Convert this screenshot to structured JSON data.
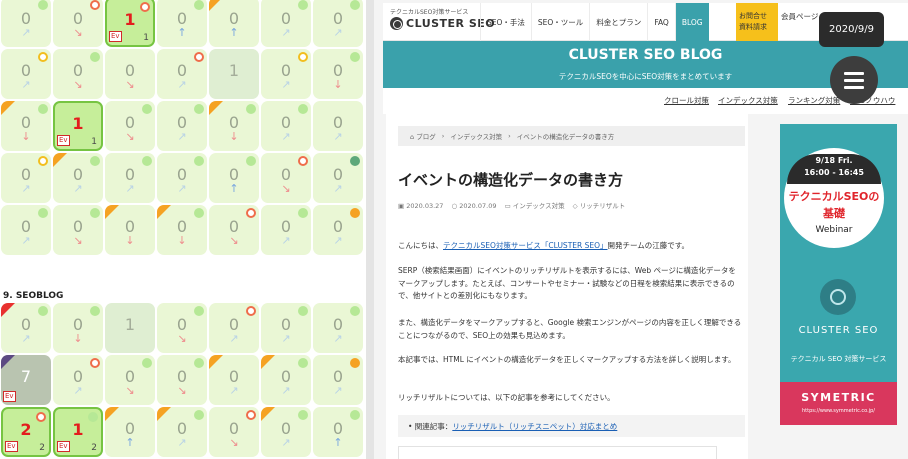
{
  "heatmap": {
    "section_label": "9. SEOBLOG",
    "ev_label": "Ev",
    "colors": {
      "cell": "#eaf7d5",
      "selected": "#c6ee9a",
      "selected_border": "#76c442",
      "hot_number": "#e31d1d"
    },
    "block1": [
      [
        {
          "v": "0",
          "a": "↗",
          "ac": "#b9d3e6",
          "dot": "green"
        },
        {
          "v": "0",
          "a": "↘",
          "ac": "#ee8d8d",
          "dot": "ring"
        },
        {
          "v": "1",
          "sel": true,
          "ev": true,
          "cnt": "1",
          "dot": "ring"
        },
        {
          "v": "0",
          "a": "↑",
          "ac": "#7aa7df",
          "dot": "green"
        },
        {
          "v": "0",
          "a": "↑",
          "ac": "#7aa7df",
          "tri": "or"
        },
        {
          "v": "0",
          "a": "↗",
          "ac": "#b9d3e6",
          "dot": "green"
        },
        {
          "v": "0",
          "a": "↗",
          "ac": "#b9d3e6",
          "dot": "green"
        }
      ],
      [
        {
          "v": "0",
          "a": "↗",
          "ac": "#b9d3e6",
          "dot": "yel"
        },
        {
          "v": "0",
          "a": "↘",
          "ac": "#ee8d8d",
          "dot": "green"
        },
        {
          "v": "0",
          "a": "↘",
          "ac": "#ee8d8d"
        },
        {
          "v": "0",
          "a": "↗",
          "ac": "#b9d3e6",
          "dot": "ring"
        },
        {
          "v": "1",
          "muted": true
        },
        {
          "v": "0",
          "a": "↗",
          "ac": "#b9d3e6",
          "dot": "yel"
        },
        {
          "v": "0",
          "a": "↓",
          "ac": "#ee8d8d",
          "dot": "green"
        }
      ],
      [
        {
          "v": "0",
          "a": "↓",
          "ac": "#ee8d8d",
          "tri": "or",
          "dot": "green"
        },
        {
          "v": "1",
          "sel": true,
          "ev": true,
          "cnt": "1"
        },
        {
          "v": "0",
          "a": "↘",
          "ac": "#ee8d8d",
          "dot": "green"
        },
        {
          "v": "0",
          "a": "↗",
          "ac": "#b9d3e6",
          "dot": "green"
        },
        {
          "v": "0",
          "a": "↓",
          "ac": "#ee8d8d",
          "tri": "or",
          "dot": "green"
        },
        {
          "v": "0",
          "a": "↗",
          "ac": "#b9d3e6",
          "dot": "green"
        },
        {
          "v": "0",
          "a": "↗",
          "ac": "#b9d3e6"
        }
      ],
      [
        {
          "v": "0",
          "a": "↗",
          "ac": "#b9d3e6",
          "dot": "yel"
        },
        {
          "v": "0",
          "a": "↗",
          "ac": "#b9d3e6",
          "tri": "or",
          "dot": "green"
        },
        {
          "v": "0",
          "a": "↗",
          "ac": "#b9d3e6",
          "dot": "green"
        },
        {
          "v": "0",
          "a": "↗",
          "ac": "#b9d3e6",
          "dot": "green"
        },
        {
          "v": "0",
          "a": "↑",
          "ac": "#7aa7df",
          "dot": "green"
        },
        {
          "v": "0",
          "a": "↘",
          "ac": "#ee8d8d",
          "dot": "ring"
        },
        {
          "v": "0",
          "a": "↗",
          "ac": "#b9d3e6",
          "dot": "dgreen"
        }
      ],
      [
        {
          "v": "0",
          "a": "↗",
          "ac": "#b9d3e6",
          "dot": "green"
        },
        {
          "v": "0",
          "a": "↘",
          "ac": "#ee8d8d",
          "dot": "green"
        },
        {
          "v": "0",
          "a": "↓",
          "ac": "#ee8d8d",
          "tri": "or"
        },
        {
          "v": "0",
          "a": "↓",
          "ac": "#ee8d8d",
          "tri": "or",
          "dot": "green"
        },
        {
          "v": "0",
          "a": "↘",
          "ac": "#ee8d8d",
          "dot": "ring"
        },
        {
          "v": "0",
          "a": "↗",
          "ac": "#b9d3e6",
          "dot": "green"
        },
        {
          "v": "0",
          "a": "↗",
          "ac": "#b9d3e6",
          "dot": "orange"
        }
      ]
    ],
    "block2": [
      [
        {
          "v": "0",
          "a": "↗",
          "ac": "#b9d3e6",
          "tri": "rd",
          "dot": "green"
        },
        {
          "v": "0",
          "a": "↓",
          "ac": "#ee8d8d",
          "dot": "green"
        },
        {
          "v": "1",
          "muted": true
        },
        {
          "v": "0",
          "a": "↘",
          "ac": "#ee8d8d",
          "dot": "green"
        },
        {
          "v": "0",
          "a": "↗",
          "ac": "#b9d3e6",
          "dot": "ring"
        },
        {
          "v": "0",
          "a": "↗",
          "ac": "#b9d3e6",
          "dot": "green"
        },
        {
          "v": "0",
          "a": "↗",
          "ac": "#b9d3e6",
          "dot": "green"
        }
      ],
      [
        {
          "v": "7",
          "gray": true,
          "ev": true,
          "tri": "pu"
        },
        {
          "v": "0",
          "a": "↗",
          "ac": "#b9d3e6",
          "dot": "ring"
        },
        {
          "v": "0",
          "a": "↘",
          "ac": "#ee8d8d",
          "dot": "green"
        },
        {
          "v": "0",
          "a": "↘",
          "ac": "#ee8d8d",
          "dot": "green"
        },
        {
          "v": "0",
          "a": "↗",
          "ac": "#b9d3e6",
          "tri": "or"
        },
        {
          "v": "0",
          "a": "↗",
          "ac": "#b9d3e6",
          "tri": "or",
          "dot": "green"
        },
        {
          "v": "0",
          "a": "↗",
          "ac": "#b9d3e6",
          "dot": "orange"
        }
      ],
      [
        {
          "v": "2",
          "sel": true,
          "ev": true,
          "cnt": "2",
          "dot": "ring"
        },
        {
          "v": "1",
          "sel": true,
          "ev": true,
          "cnt": "2",
          "dot": "green"
        },
        {
          "v": "0",
          "a": "↑",
          "ac": "#7aa7df",
          "tri": "or"
        },
        {
          "v": "0",
          "a": "↗",
          "ac": "#b9d3e6",
          "tri": "or",
          "dot": "green"
        },
        {
          "v": "0",
          "a": "↘",
          "ac": "#ee8d8d",
          "dot": "ring"
        },
        {
          "v": "0",
          "a": "↗",
          "ac": "#b9d3e6",
          "tri": "or",
          "dot": "green"
        },
        {
          "v": "0",
          "a": "↑",
          "ac": "#7aa7df",
          "dot": "green"
        }
      ]
    ]
  },
  "site": {
    "logo_sub": "テクニカルSEO対策サービス",
    "logo_text": "CLUSTER SEO",
    "nav": [
      "SEO・手法",
      "SEO・ツール",
      "料金とプラン",
      "FAQ",
      "BLOG"
    ],
    "nav_active_index": 4,
    "contact": "お問合せ 資料請求",
    "member": "会員ページ (ログイン)",
    "date_tooltip": "2020/9/9",
    "hero_title": "CLUSTER SEO BLOG",
    "hero_sub": "テクニカルSEOを中心にSEO対策をまとめています",
    "subnav": [
      "クロール対策",
      "インデックス対策",
      "ランキング対策",
      "SEOノウハウ"
    ],
    "colors": {
      "accent": "#3aa1ab",
      "contact": "#f6c01b",
      "link": "#1a5fb4"
    }
  },
  "article": {
    "breadcrumb": [
      "⌂ ブログ",
      "›",
      "インデックス対策",
      "›",
      "イベントの構造化データの書き方"
    ],
    "title": "イベントの構造化データの書き方",
    "meta": [
      "▣ 2020.03.27",
      "○ 2020.07.09",
      "▭ インデックス対策",
      "◇ リッチリザルト"
    ],
    "p1_pre": "こんにちは、",
    "p1_link": "テクニカルSEO対策サービス「CLUSTER SEO」",
    "p1_post": "開発チームの江藤です。",
    "p2": "SERP（検索結果画面）にイベントのリッチリザルトを表示するには、Web ページに構造化データをマークアップします。たとえば、コンサートやセミナー・試験などの日程を検索結果に表示できるので、他サイトとの差別化にもなります。",
    "p3": "また、構造化データをマークアップすると、Google 検索エンジンがページの内容を正しく理解できることにつながるので、SEO上の効果も見込めます。",
    "p4": "本記事では、HTML にイベントの構造化データを正しくマークアップする方法を詳しく説明します。",
    "p5": "リッチリザルトについては、以下の記事を参考にしてください。",
    "related_pre": "•  関連記事：",
    "related_link": "リッチリザルト（リッチスニペット）対応まとめ"
  },
  "banner": {
    "top": "9/18 Fri.",
    "time": "16:00 - 16:45",
    "headline_1": "テクニカルSEOの",
    "headline_2": "基礎",
    "webinar": "Webinar",
    "brand": "CLUSTER SEO",
    "service": "テクニカル SEO 対策サービス",
    "sym_name": "SYMETRIC",
    "sym_url": "https://www.symmetric.co.jp/",
    "colors": {
      "bg": "#3aa7ae",
      "sym": "#d9375d"
    }
  }
}
